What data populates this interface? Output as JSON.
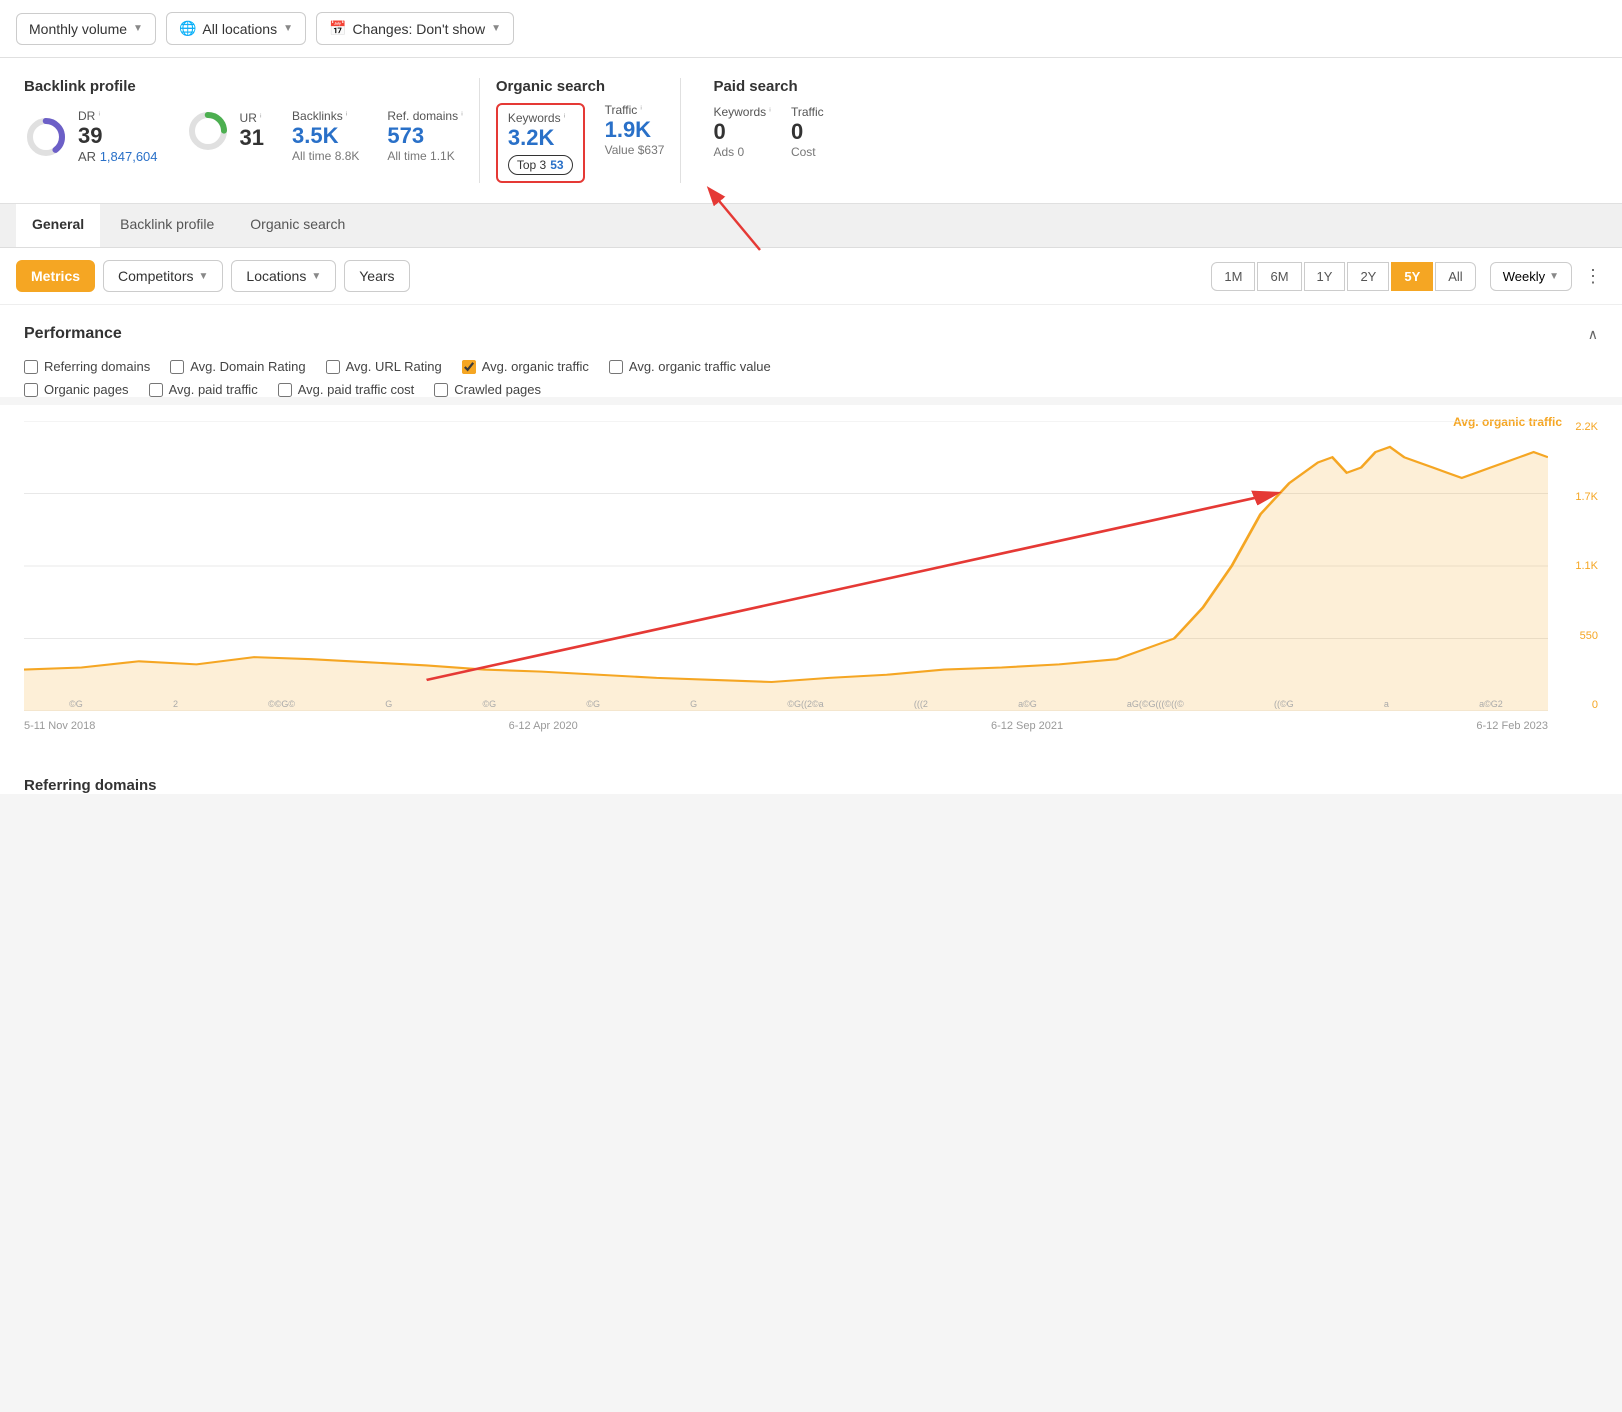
{
  "toolbar": {
    "monthly_volume_label": "Monthly volume",
    "all_locations_label": "All locations",
    "changes_label": "Changes: Don't show"
  },
  "backlink_profile": {
    "title": "Backlink profile",
    "dr_label": "DR",
    "dr_value": "39",
    "ar_label": "AR",
    "ar_value": "1,847,604",
    "ur_label": "UR",
    "ur_value": "31",
    "backlinks_label": "Backlinks",
    "backlinks_value": "3.5K",
    "backlinks_alltime": "All time  8.8K",
    "ref_domains_label": "Ref. domains",
    "ref_domains_value": "573",
    "ref_domains_alltime": "All time  1.1K"
  },
  "organic_search": {
    "title": "Organic search",
    "keywords_label": "Keywords",
    "keywords_value": "3.2K",
    "top3_label": "Top 3",
    "top3_value": "53",
    "traffic_label": "Traffic",
    "traffic_value": "1.9K",
    "value_label": "Value",
    "value_value": "$637"
  },
  "paid_search": {
    "title": "Paid search",
    "keywords_label": "Keywords",
    "keywords_value": "0",
    "traffic_label": "Traffic",
    "traffic_value": "0",
    "ads_label": "Ads",
    "ads_value": "0",
    "cost_label": "Cost"
  },
  "tabs": {
    "items": [
      {
        "label": "General",
        "active": true
      },
      {
        "label": "Backlink profile",
        "active": false
      },
      {
        "label": "Organic search",
        "active": false
      }
    ]
  },
  "filter_bar": {
    "metrics_label": "Metrics",
    "competitors_label": "Competitors",
    "locations_label": "Locations",
    "years_label": "Years",
    "time_buttons": [
      "1M",
      "6M",
      "1Y",
      "2Y",
      "5Y",
      "All"
    ],
    "active_time": "5Y",
    "weekly_label": "Weekly"
  },
  "performance": {
    "title": "Performance",
    "checkboxes": [
      {
        "label": "Referring domains",
        "checked": false
      },
      {
        "label": "Avg. Domain Rating",
        "checked": false
      },
      {
        "label": "Avg. URL Rating",
        "checked": false
      },
      {
        "label": "Avg. organic traffic",
        "checked": true
      },
      {
        "label": "Avg. organic traffic value",
        "checked": false
      }
    ],
    "checkboxes2": [
      {
        "label": "Organic pages",
        "checked": false
      },
      {
        "label": "Avg. paid traffic",
        "checked": false
      },
      {
        "label": "Avg. paid traffic cost",
        "checked": false
      },
      {
        "label": "Crawled pages",
        "checked": false
      }
    ]
  },
  "chart": {
    "active_metric": "Avg. organic traffic",
    "y_labels": [
      "2.2K",
      "1.7K",
      "1.1K",
      "550",
      "0"
    ],
    "x_labels": [
      "5-11 Nov 2018",
      "6-12 Apr 2020",
      "6-12 Sep 2021",
      "6-12 Feb 2023"
    ],
    "accent_color": "#f5a623"
  },
  "referring_domains": {
    "title": "Referring domains"
  }
}
